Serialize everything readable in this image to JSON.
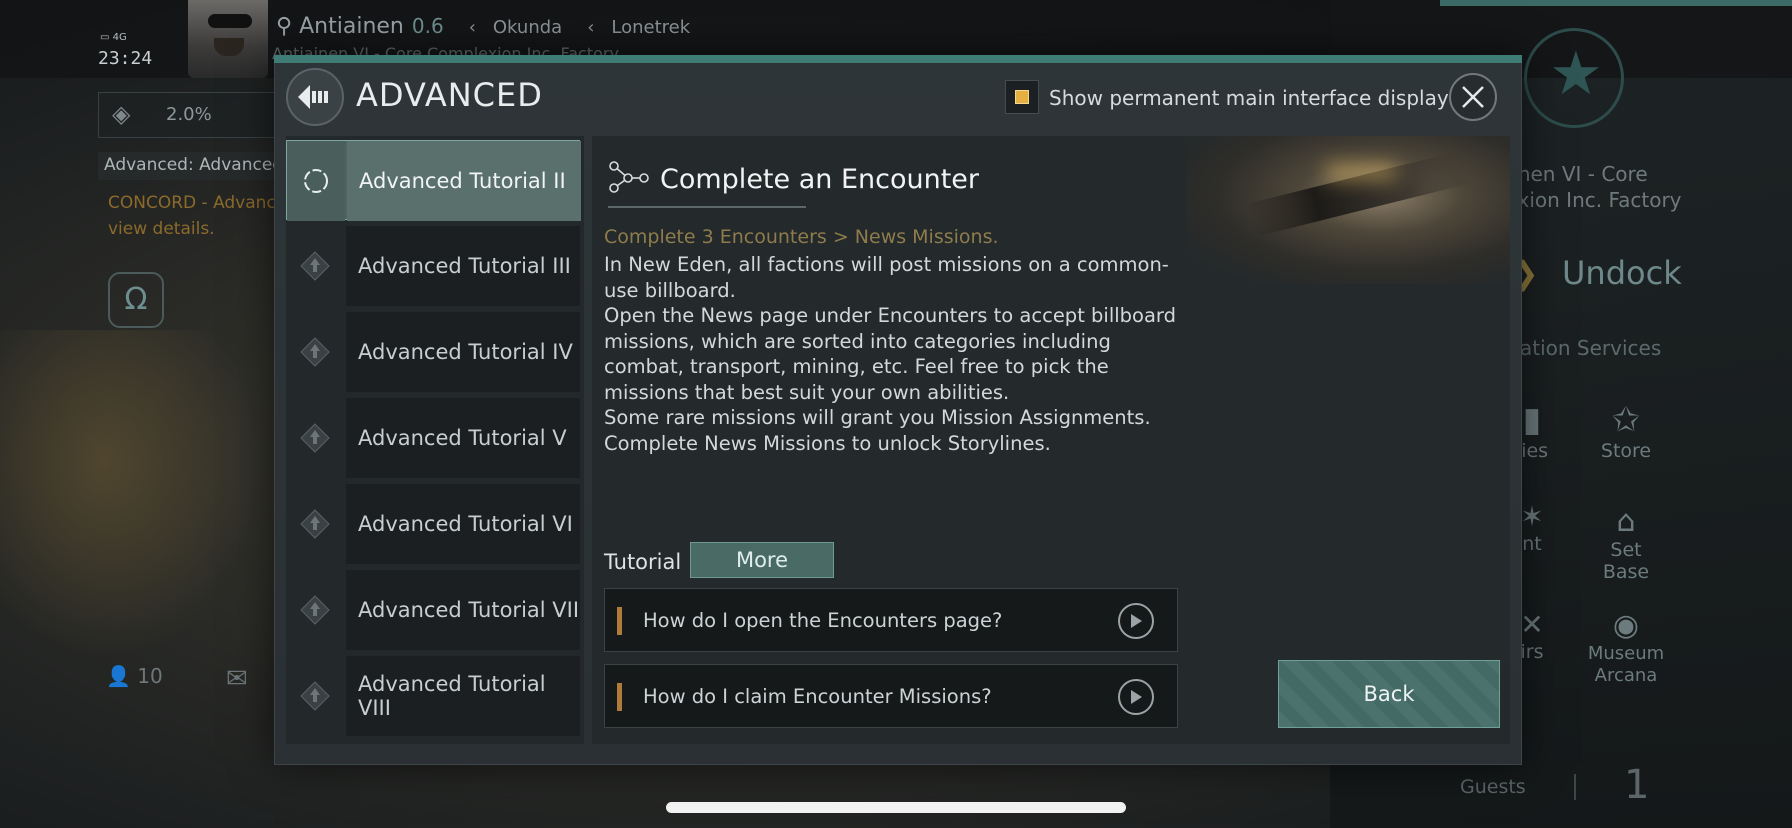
{
  "status_bar": {
    "network": "4G",
    "time": "23:24"
  },
  "background_hud": {
    "location": {
      "system": "Antiainen",
      "security": "0.6",
      "constellation": "Okunda",
      "region": "Lonetrek",
      "station": "Antiainen VI - Core Complexion Inc. Factory"
    },
    "progress_percent": "2.0%",
    "progress_label": "Advanced: Advanced",
    "mission_notice": [
      "CONCORD - Advanc",
      "view details."
    ],
    "people_count": "10",
    "station_right_title": [
      "ainen VI - Core",
      "lexion Inc. Factory"
    ],
    "undock_label": "Undock",
    "services_label": "ation Services",
    "services": [
      {
        "label": "lies",
        "icon": "item-icon"
      },
      {
        "label": "Store",
        "icon": "nes-store-icon"
      },
      {
        "label": "nt",
        "icon": "star-icon"
      },
      {
        "label": "Set Base",
        "icon": "set-base-icon"
      },
      {
        "label": "irs",
        "icon": "repair-icon"
      },
      {
        "label": "Museum Arcana",
        "icon": "museum-icon"
      }
    ],
    "guests_label": "Guests",
    "guests_count": "1"
  },
  "dialog": {
    "title": "ADVANCED",
    "permanent_display_label": "Show permanent main interface display",
    "permanent_display_checked": true,
    "tutorials": [
      {
        "label": "Advanced Tutorial II",
        "active": true,
        "icon": "in-progress-icon"
      },
      {
        "label": "Advanced Tutorial III",
        "active": false,
        "icon": "locked-diamond-icon"
      },
      {
        "label": "Advanced Tutorial IV",
        "active": false,
        "icon": "locked-diamond-icon"
      },
      {
        "label": "Advanced Tutorial V",
        "active": false,
        "icon": "locked-diamond-icon"
      },
      {
        "label": "Advanced Tutorial VI",
        "active": false,
        "icon": "locked-diamond-icon"
      },
      {
        "label": "Advanced Tutorial VII",
        "active": false,
        "icon": "locked-diamond-icon"
      },
      {
        "label": "Advanced Tutorial VIII",
        "active": false,
        "icon": "locked-diamond-icon"
      }
    ],
    "detail": {
      "title": "Complete an Encounter",
      "objective": "Complete 3 Encounters > News Missions.",
      "body_lines": [
        "In New Eden, all factions will post missions on a common-use billboard.",
        "Open the News page under Encounters to accept billboard missions, which are sorted into categories including combat, transport, mining, etc. Feel free to pick the missions that best suit your own abilities.",
        "Some rare missions will grant you Mission Assignments.",
        "Complete News Missions to unlock Storylines."
      ],
      "tutorial_label": "Tutorial",
      "more_label": "More",
      "faqs": [
        {
          "question": "How do I open the Encounters page?"
        },
        {
          "question": "How do I claim Encounter Missions?"
        }
      ],
      "back_label": "Back"
    }
  },
  "colors": {
    "accent_teal": "#4a6a66",
    "objective_gold": "#8e7c4c",
    "checkbox_yellow": "#e6b040"
  }
}
